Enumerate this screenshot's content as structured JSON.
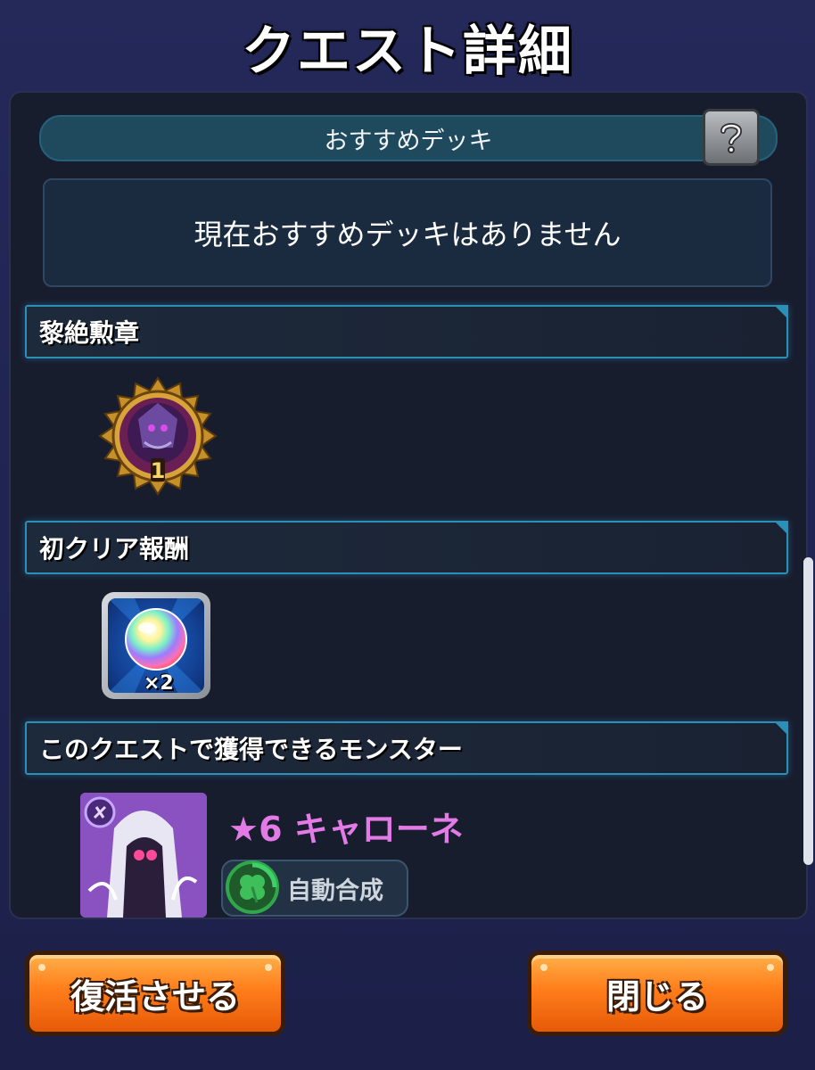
{
  "window": {
    "title": "クエスト詳細"
  },
  "recommended_deck": {
    "header_label": "おすすめデッキ",
    "help_icon": "question-icon",
    "empty_message": "現在おすすめデッキはありません"
  },
  "sections": {
    "medal": {
      "label": "黎絶勲章",
      "medal_number": "1"
    },
    "first_clear": {
      "label": "初クリア報酬",
      "reward_count": "×2",
      "reward_icon": "rainbow-orb-icon"
    },
    "monsters": {
      "label": "このクエストで獲得できるモンスター",
      "monster_name": "★6 キャローネ",
      "auto_label": "自動合成"
    }
  },
  "buttons": {
    "revive": "復活させる",
    "close": "閉じる"
  },
  "colors": {
    "accent_orange": "#ff7d1a",
    "section_border": "#2c8fb8",
    "monster_name": "#e27be6"
  }
}
